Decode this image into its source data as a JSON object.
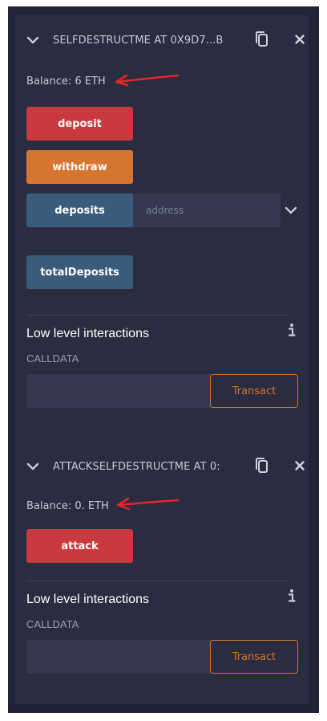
{
  "contracts": [
    {
      "name": "SELFDESTRUCTME AT 0X9D7...B",
      "balance": "Balance: 6 ETH",
      "functions": [
        {
          "label": "deposit"
        },
        {
          "label": "withdraw"
        },
        {
          "label": "deposits",
          "input_placeholder": "address"
        },
        {
          "label": "totalDeposits"
        }
      ],
      "low_level": {
        "title": "Low level interactions",
        "calldata_label": "CALLDATA",
        "calldata_value": "",
        "transact_label": "Transact"
      }
    },
    {
      "name": "ATTACKSELFDESTRUCTME AT 0:",
      "balance": "Balance: 0. ETH",
      "functions": [
        {
          "label": "attack"
        }
      ],
      "low_level": {
        "title": "Low level interactions",
        "calldata_label": "CALLDATA",
        "calldata_value": "",
        "transact_label": "Transact"
      }
    }
  ],
  "colors": {
    "panel_bg": "#2a2c3f",
    "outer_bg": "#222336",
    "payable_button": "#c9393f",
    "transaction_button": "#d5752f",
    "call_button": "#3b5b7d",
    "annotation_arrow": "#e5262b",
    "text_primary": "#ffffff",
    "text_secondary": "#c8cad9"
  },
  "icons": {
    "collapse": "chevron-down-icon",
    "copy": "copy-icon",
    "remove": "close-icon",
    "expand": "chevron-down-icon",
    "info": "info-icon"
  }
}
